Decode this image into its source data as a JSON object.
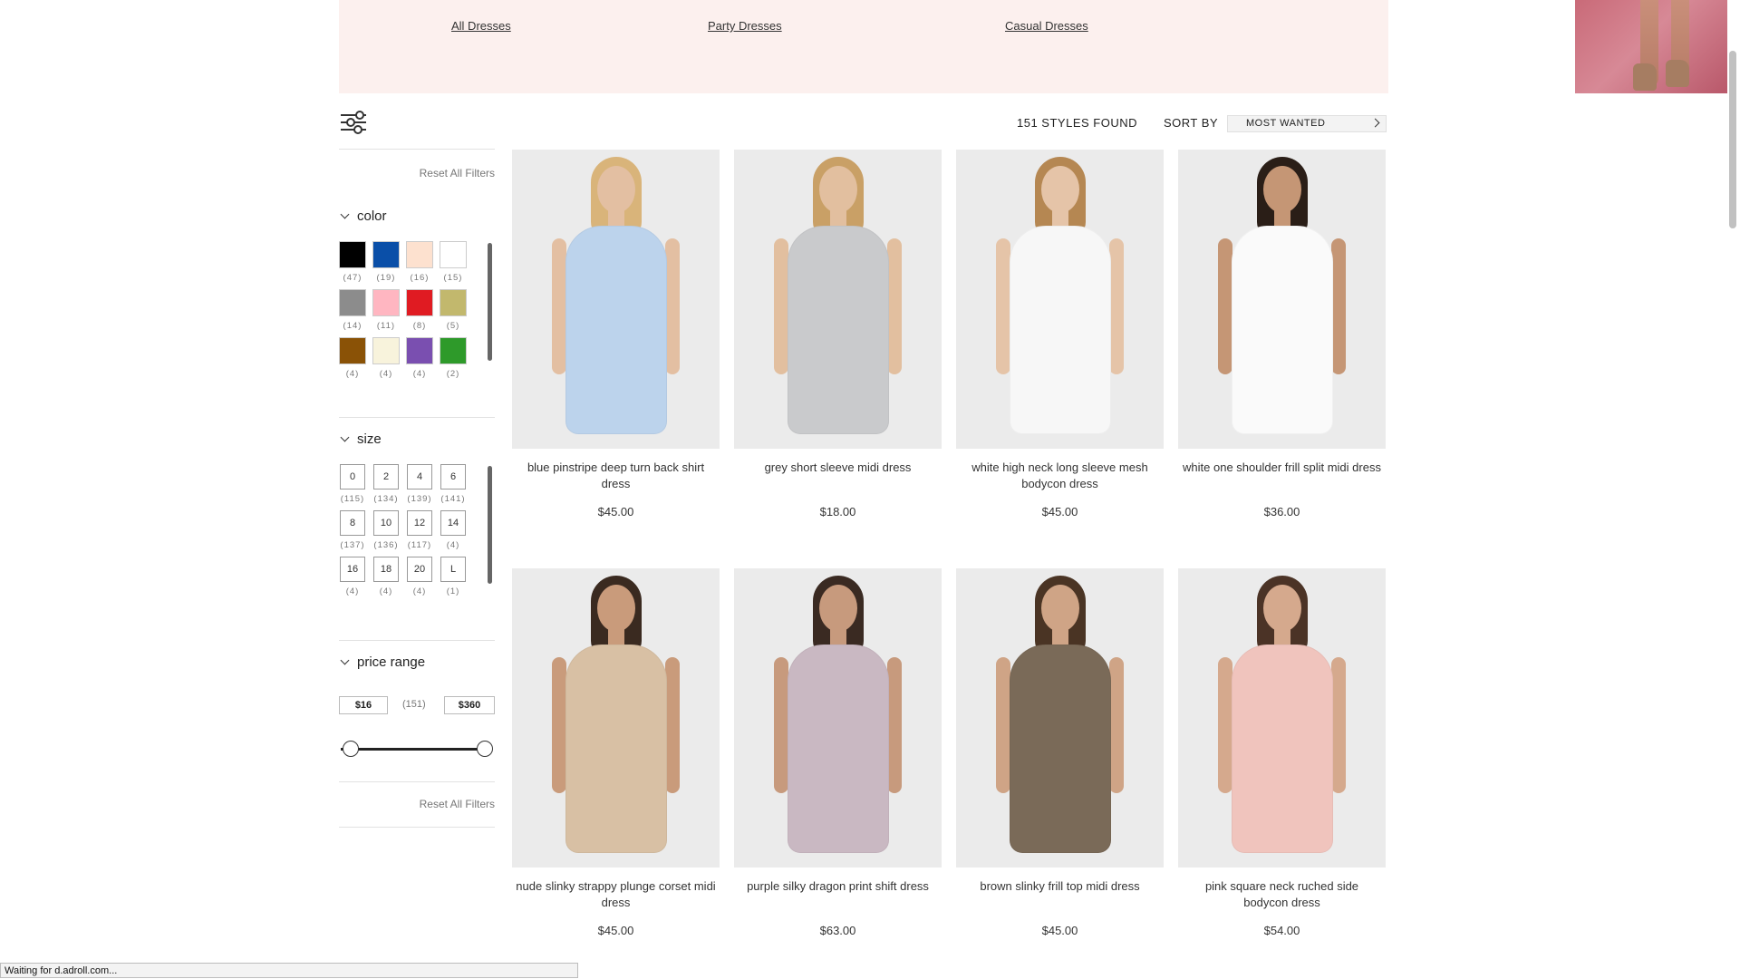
{
  "banner": {
    "links": [
      "All Dresses",
      "Party Dresses",
      "Casual Dresses"
    ]
  },
  "filters": {
    "reset_label": "Reset All Filters",
    "color": {
      "title": "color",
      "swatches": [
        {
          "hex": "#000000",
          "count": "(47)"
        },
        {
          "hex": "#0a4fa8",
          "count": "(19)"
        },
        {
          "hex": "#fde1cf",
          "count": "(16)"
        },
        {
          "hex": "#ffffff",
          "count": "(15)"
        },
        {
          "hex": "#8c8c8c",
          "count": "(14)"
        },
        {
          "hex": "#ffb6c1",
          "count": "(11)"
        },
        {
          "hex": "#e01b22",
          "count": "(8)"
        },
        {
          "hex": "#c2b86d",
          "count": "(5)"
        },
        {
          "hex": "#8a5206",
          "count": "(4)"
        },
        {
          "hex": "#f8f3dc",
          "count": "(4)"
        },
        {
          "hex": "#7a4fb0",
          "count": "(4)"
        },
        {
          "hex": "#2e9a2a",
          "count": "(2)"
        }
      ]
    },
    "size": {
      "title": "size",
      "options": [
        {
          "label": "0",
          "count": "(115)"
        },
        {
          "label": "2",
          "count": "(134)"
        },
        {
          "label": "4",
          "count": "(139)"
        },
        {
          "label": "6",
          "count": "(141)"
        },
        {
          "label": "8",
          "count": "(137)"
        },
        {
          "label": "10",
          "count": "(136)"
        },
        {
          "label": "12",
          "count": "(117)"
        },
        {
          "label": "14",
          "count": "(4)"
        },
        {
          "label": "16",
          "count": "(4)"
        },
        {
          "label": "18",
          "count": "(4)"
        },
        {
          "label": "20",
          "count": "(4)"
        },
        {
          "label": "L",
          "count": "(1)"
        }
      ]
    },
    "price_range": {
      "title": "price range",
      "min": "$16",
      "max": "$360",
      "count": "(151)"
    }
  },
  "toolbar": {
    "styles_found": "151 STYLES FOUND",
    "sort_label": "SORT BY",
    "sort_value": "MOST WANTED"
  },
  "products": [
    {
      "name": "blue pinstripe deep turn back shirt dress",
      "price": "$45.00",
      "colors": {
        "dress": "#bcd3ec",
        "hair": "#d9b47a",
        "skin": "#e3bfa2"
      }
    },
    {
      "name": "grey short sleeve midi dress",
      "price": "$18.00",
      "colors": {
        "dress": "#c9cacc",
        "hair": "#c9a066",
        "skin": "#e2bf9f"
      }
    },
    {
      "name": "white high neck long sleeve mesh bodycon dress",
      "price": "$45.00",
      "colors": {
        "dress": "#f7f7f7",
        "hair": "#b58752",
        "skin": "#e5c4a8"
      }
    },
    {
      "name": "white one shoulder frill split midi dress",
      "price": "$36.00",
      "colors": {
        "dress": "#fafafa",
        "hair": "#2a1e17",
        "skin": "#c59675"
      }
    },
    {
      "name": "nude slinky strappy plunge corset midi dress",
      "price": "$45.00",
      "colors": {
        "dress": "#d8c0a4",
        "hair": "#3a2a20",
        "skin": "#c99b7b"
      }
    },
    {
      "name": "purple silky dragon print shift dress",
      "price": "$63.00",
      "colors": {
        "dress": "#c9b8c2",
        "hair": "#3a2a22",
        "skin": "#c79a7d"
      }
    },
    {
      "name": "brown slinky frill top midi dress",
      "price": "$45.00",
      "colors": {
        "dress": "#7a6a58",
        "hair": "#4a3424",
        "skin": "#cfa486"
      }
    },
    {
      "name": "pink square neck ruched side bodycon dress",
      "price": "$54.00",
      "colors": {
        "dress": "#f0c4bd",
        "hair": "#4b3326",
        "skin": "#d5a98d"
      }
    }
  ],
  "status_bar": "Waiting for d.adroll.com..."
}
